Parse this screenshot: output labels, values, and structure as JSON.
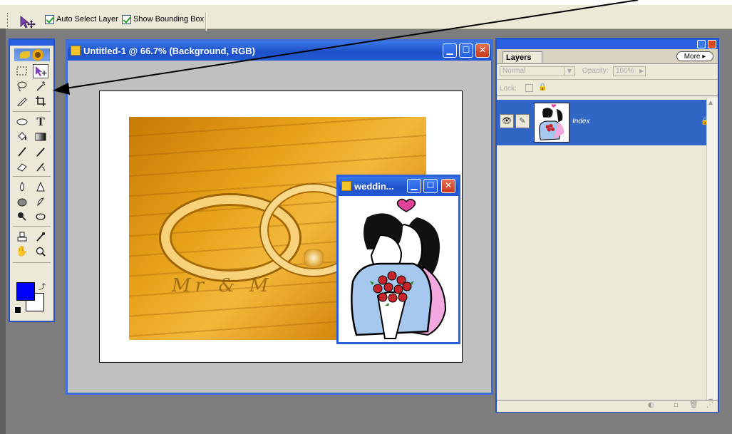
{
  "options_bar": {
    "auto_select_label": "Auto Select Layer",
    "show_bounding_label": "Show Bounding Box"
  },
  "document": {
    "title": "Untitled-1 @ 66.7% (Background, RGB)",
    "photo_text": "Mr  &  M"
  },
  "clipart_window": {
    "title": "weddin..."
  },
  "layers_panel": {
    "tab_label": "Layers",
    "more_button": "More ▸",
    "blend_mode": "Normal",
    "opacity_label": "Opacity:",
    "opacity_value": "100%",
    "lock_label": "Lock:",
    "layers": [
      {
        "name": "Index",
        "visible": true
      }
    ]
  },
  "colors": {
    "foreground": "#0000ff",
    "background": "#ffffff",
    "title_bar": "#2459d6",
    "selection": "#3166c4"
  }
}
